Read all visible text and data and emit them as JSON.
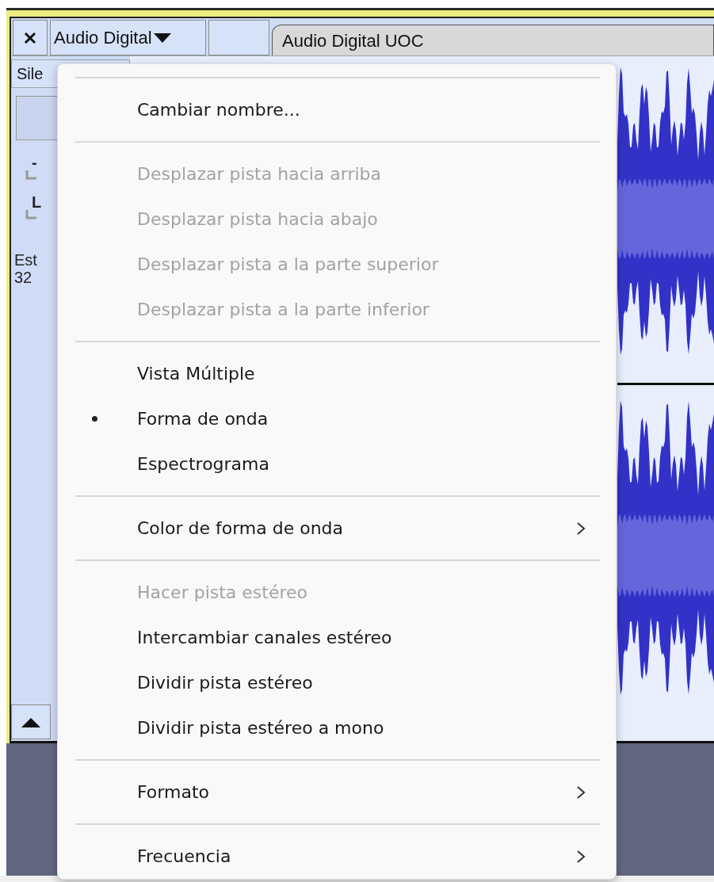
{
  "track_header": {
    "name_menu": "Audio Digital",
    "title_tab": "Audio Digital UOC"
  },
  "track_controls": {
    "mute_button": "Sile",
    "gain_label": "-",
    "pan_label": "L",
    "info_lines": [
      "Est",
      "32"
    ]
  },
  "context_menu": {
    "sections": [
      [
        {
          "label": "Cambiar nombre...",
          "disabled": false,
          "has_submenu": false
        }
      ],
      [
        {
          "label": "Desplazar pista hacia arriba",
          "disabled": true,
          "has_submenu": false
        },
        {
          "label": "Desplazar pista hacia abajo",
          "disabled": true,
          "has_submenu": false
        },
        {
          "label": "Desplazar pista a la parte superior",
          "disabled": true,
          "has_submenu": false
        },
        {
          "label": "Desplazar pista a la parte inferior",
          "disabled": true,
          "has_submenu": false
        }
      ],
      [
        {
          "label": "Vista Múltiple",
          "disabled": false,
          "has_submenu": false,
          "selected": false
        },
        {
          "label": "Forma de onda",
          "disabled": false,
          "has_submenu": false,
          "selected": true
        },
        {
          "label": "Espectrograma",
          "disabled": false,
          "has_submenu": false,
          "selected": false
        }
      ],
      [
        {
          "label": "Color de forma de onda",
          "disabled": false,
          "has_submenu": true
        }
      ],
      [
        {
          "label": "Hacer pista estéreo",
          "disabled": true,
          "has_submenu": false
        },
        {
          "label": "Intercambiar canales estéreo",
          "disabled": false,
          "has_submenu": false
        },
        {
          "label": "Dividir pista estéreo",
          "disabled": false,
          "has_submenu": false
        },
        {
          "label": "Dividir pista estéreo a mono",
          "disabled": false,
          "has_submenu": false
        }
      ],
      [
        {
          "label": "Formato",
          "disabled": false,
          "has_submenu": true
        }
      ],
      [
        {
          "label": "Frecuencia",
          "disabled": false,
          "has_submenu": true
        }
      ]
    ]
  }
}
